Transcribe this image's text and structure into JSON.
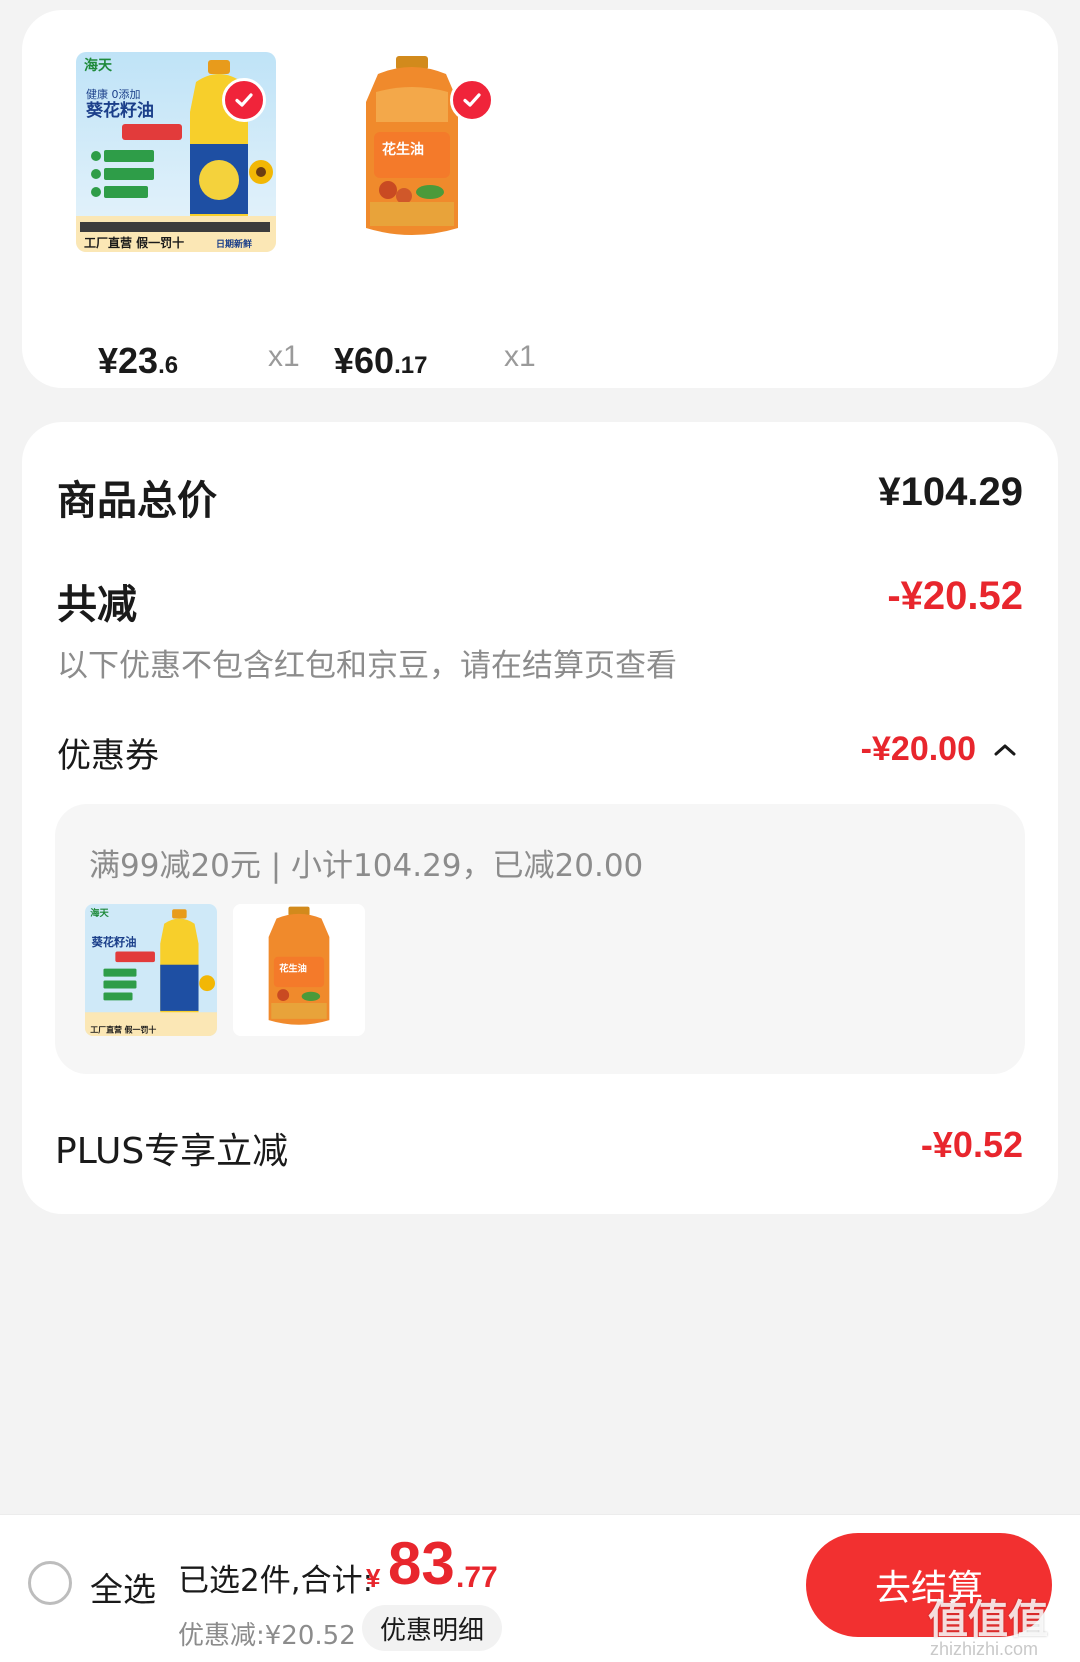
{
  "products": [
    {
      "name_brand": "海天",
      "image_label": "葵花籽油",
      "price_int": "¥23",
      "price_dec": ".6",
      "qty": "x1",
      "checked": true
    },
    {
      "image_label": "花生油",
      "price_int": "¥60",
      "price_dec": ".17",
      "qty": "x1",
      "checked": true
    }
  ],
  "summary": {
    "total_label": "商品总价",
    "total_value": "¥104.29",
    "reduce_label": "共减",
    "reduce_value": "-¥20.52",
    "reduce_note": "以下优惠不包含红包和京豆，请在结算页查看",
    "coupon_label": "优惠券",
    "coupon_value": "-¥20.00",
    "coupon_rule": "满99减20元 | 小计104.29，已减20.00",
    "plus_label": "PLUS专享立减",
    "plus_value": "-¥0.52"
  },
  "bottom_bar": {
    "select_all": "全选",
    "selected_text": "已选2件,合计:",
    "total_yen": "¥",
    "total_int": "83",
    "total_dec": ".77",
    "discount_text": "优惠减:¥20.52",
    "detail_button": "优惠明细",
    "checkout_button": "去结算",
    "watermark": "值值值",
    "watermark_sub": "zhizhizhi.com"
  },
  "colors": {
    "accent_red": "#e8262d",
    "checkout_red": "#f23030",
    "muted_gray": "#8c8c8c",
    "background": "#f3f3f3"
  },
  "icons": [
    "check-icon",
    "chevron-up-icon",
    "radio-unchecked-icon"
  ]
}
